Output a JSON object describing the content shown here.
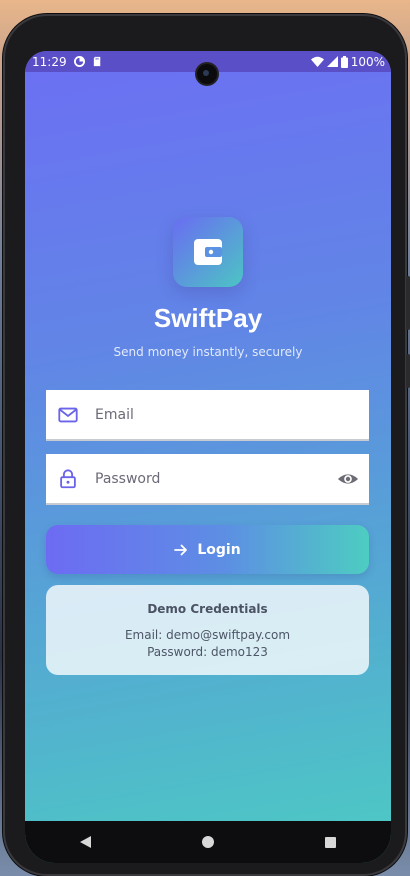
{
  "status_bar": {
    "time": "11:29",
    "battery": "100%"
  },
  "app": {
    "name": "SwiftPay",
    "tagline": "Send money instantly, securely",
    "logo_icon": "wallet-icon",
    "accent_start": "#6c6ff4",
    "accent_end": "#4ccbc3"
  },
  "form": {
    "email_placeholder": "Email",
    "email_value": "",
    "password_placeholder": "Password",
    "password_value": "",
    "login_label": "Login"
  },
  "demo": {
    "title": "Demo Credentials",
    "email_line": "Email: demo@swiftpay.com",
    "password_line": "Password: demo123"
  },
  "nav": {
    "back_icon": "back-triangle-icon",
    "home_icon": "home-circle-icon",
    "recents_icon": "recents-square-icon"
  }
}
